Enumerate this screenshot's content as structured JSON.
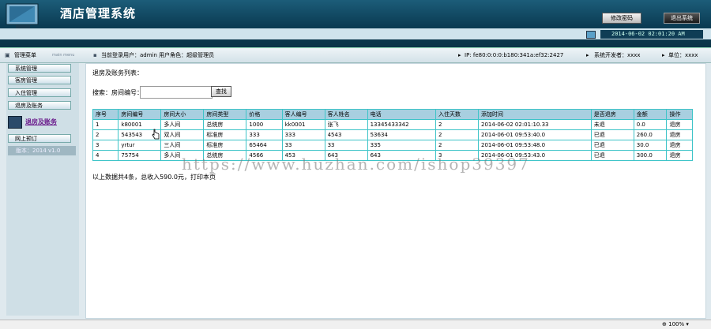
{
  "header": {
    "title": "酒店管理系统",
    "change_password": "修改密码",
    "logout": "退出系统",
    "datetime": "2014-06-02 02:01:20 AM"
  },
  "infobar": {
    "menu_title": "管理菜单",
    "menu_sub": "main menu",
    "current_user": "当前登录用户：admin   用户角色：超级管理员",
    "ip": "IP: fe80:0:0:0:b180:341a:ef32:2427",
    "developer": "系统开发者：xxxx",
    "unit": "单位：xxxx"
  },
  "sidebar": {
    "items": [
      {
        "label": "系统管理"
      },
      {
        "label": "客房管理"
      },
      {
        "label": "入住管理"
      },
      {
        "label": "退房及账务"
      },
      {
        "label": "退房及账务"
      },
      {
        "label": "网上预订"
      }
    ],
    "version": "版本：2014 v1.0"
  },
  "main": {
    "heading": "退房及账务列表：",
    "search_label": "搜索：房间编号：",
    "search_value": "",
    "search_button": "查找",
    "columns": [
      "序号",
      "房间编号",
      "房间大小",
      "房间类型",
      "价格",
      "客人编号",
      "客人姓名",
      "电话",
      "入住天数",
      "添加时间",
      "是否退房",
      "金额",
      "操作"
    ],
    "rows": [
      [
        "1",
        "k80001",
        "多人间",
        "总统房",
        "1000",
        "kk0001",
        "张飞",
        "13345433342",
        "2",
        "2014-06-02 02:01:10.33",
        "未退",
        "0.0",
        "退房"
      ],
      [
        "2",
        "543543",
        "双人间",
        "标准房",
        "333",
        "333",
        "4543",
        "53634",
        "2",
        "2014-06-01 09:53:40.0",
        "已退",
        "260.0",
        "退房"
      ],
      [
        "3",
        "yrtur",
        "三人间",
        "标准房",
        "65464",
        "33",
        "33",
        "335",
        "2",
        "2014-06-01 09:53:48.0",
        "已退",
        "30.0",
        "退房"
      ],
      [
        "4",
        "75754",
        "多人间",
        "总统房",
        "4566",
        "453",
        "643",
        "643",
        "3",
        "2014-06-01 09:53:43.0",
        "已退",
        "300.0",
        "退房"
      ]
    ],
    "summary": "以上数据共4条，总收入590.0元，打印本页"
  },
  "watermark": "https://www.huzhan.com/ishop39397",
  "statusbar": {
    "zoom": "100%"
  }
}
